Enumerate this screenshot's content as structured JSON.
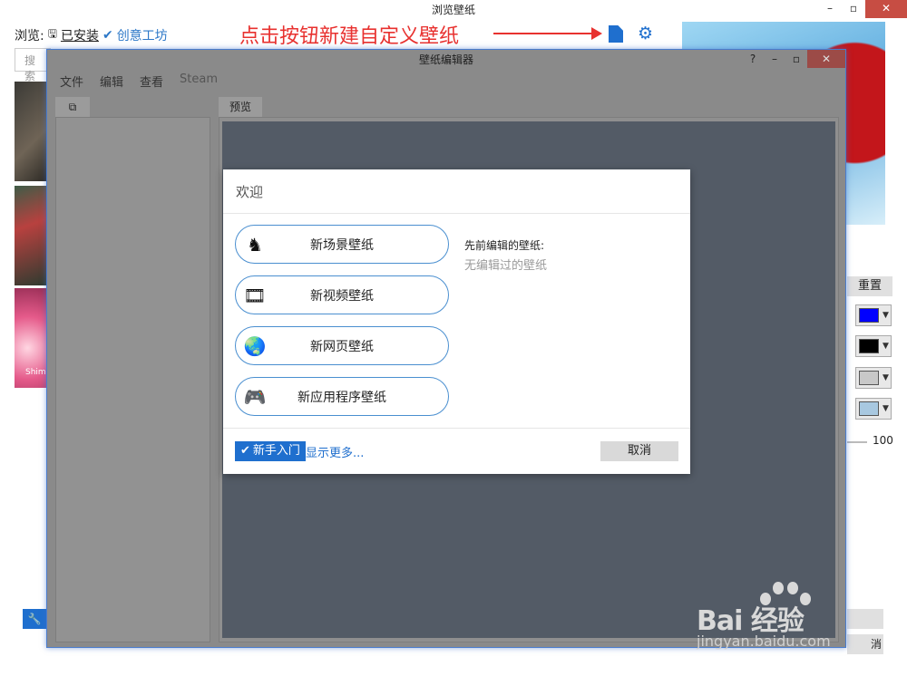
{
  "bg_window": {
    "title": "浏览壁纸",
    "browse_label": "浏览:",
    "installed_label": "已安装",
    "workshop_label": "创意工坊",
    "search_placeholder": "搜索",
    "thumb3_caption": "Shim",
    "reset_label": "重置",
    "slider_value": "100",
    "bottom_right_label": "消",
    "colors": [
      "#0000ff",
      "#000000",
      "#c8c8c8",
      "#a8c8e0"
    ]
  },
  "annotation": {
    "text": "点击按钮新建自定义壁纸",
    "color": "#e8312f"
  },
  "editor": {
    "title": "壁纸编辑器",
    "help": "?",
    "menu": [
      "文件",
      "编辑",
      "查看",
      "Steam"
    ],
    "preview_tab": "预览"
  },
  "dialog": {
    "title": "欢迎",
    "buttons": [
      {
        "label": "新场景壁纸",
        "icon": "chess-knight-icon",
        "glyph": "♞"
      },
      {
        "label": "新视频壁纸",
        "icon": "film-icon",
        "glyph": "🎞"
      },
      {
        "label": "新网页壁纸",
        "icon": "globe-icon",
        "glyph": "🌏"
      },
      {
        "label": "新应用程序壁纸",
        "icon": "gamepad-icon",
        "glyph": "🎮"
      }
    ],
    "previous_title": "先前编辑的壁纸:",
    "previous_none": "无编辑过的壁纸",
    "getting_started": "新手入门",
    "show_more": "显示更多...",
    "cancel": "取消"
  },
  "watermark": {
    "logo": "Bai  经验",
    "url": "jingyan.baidu.com"
  }
}
